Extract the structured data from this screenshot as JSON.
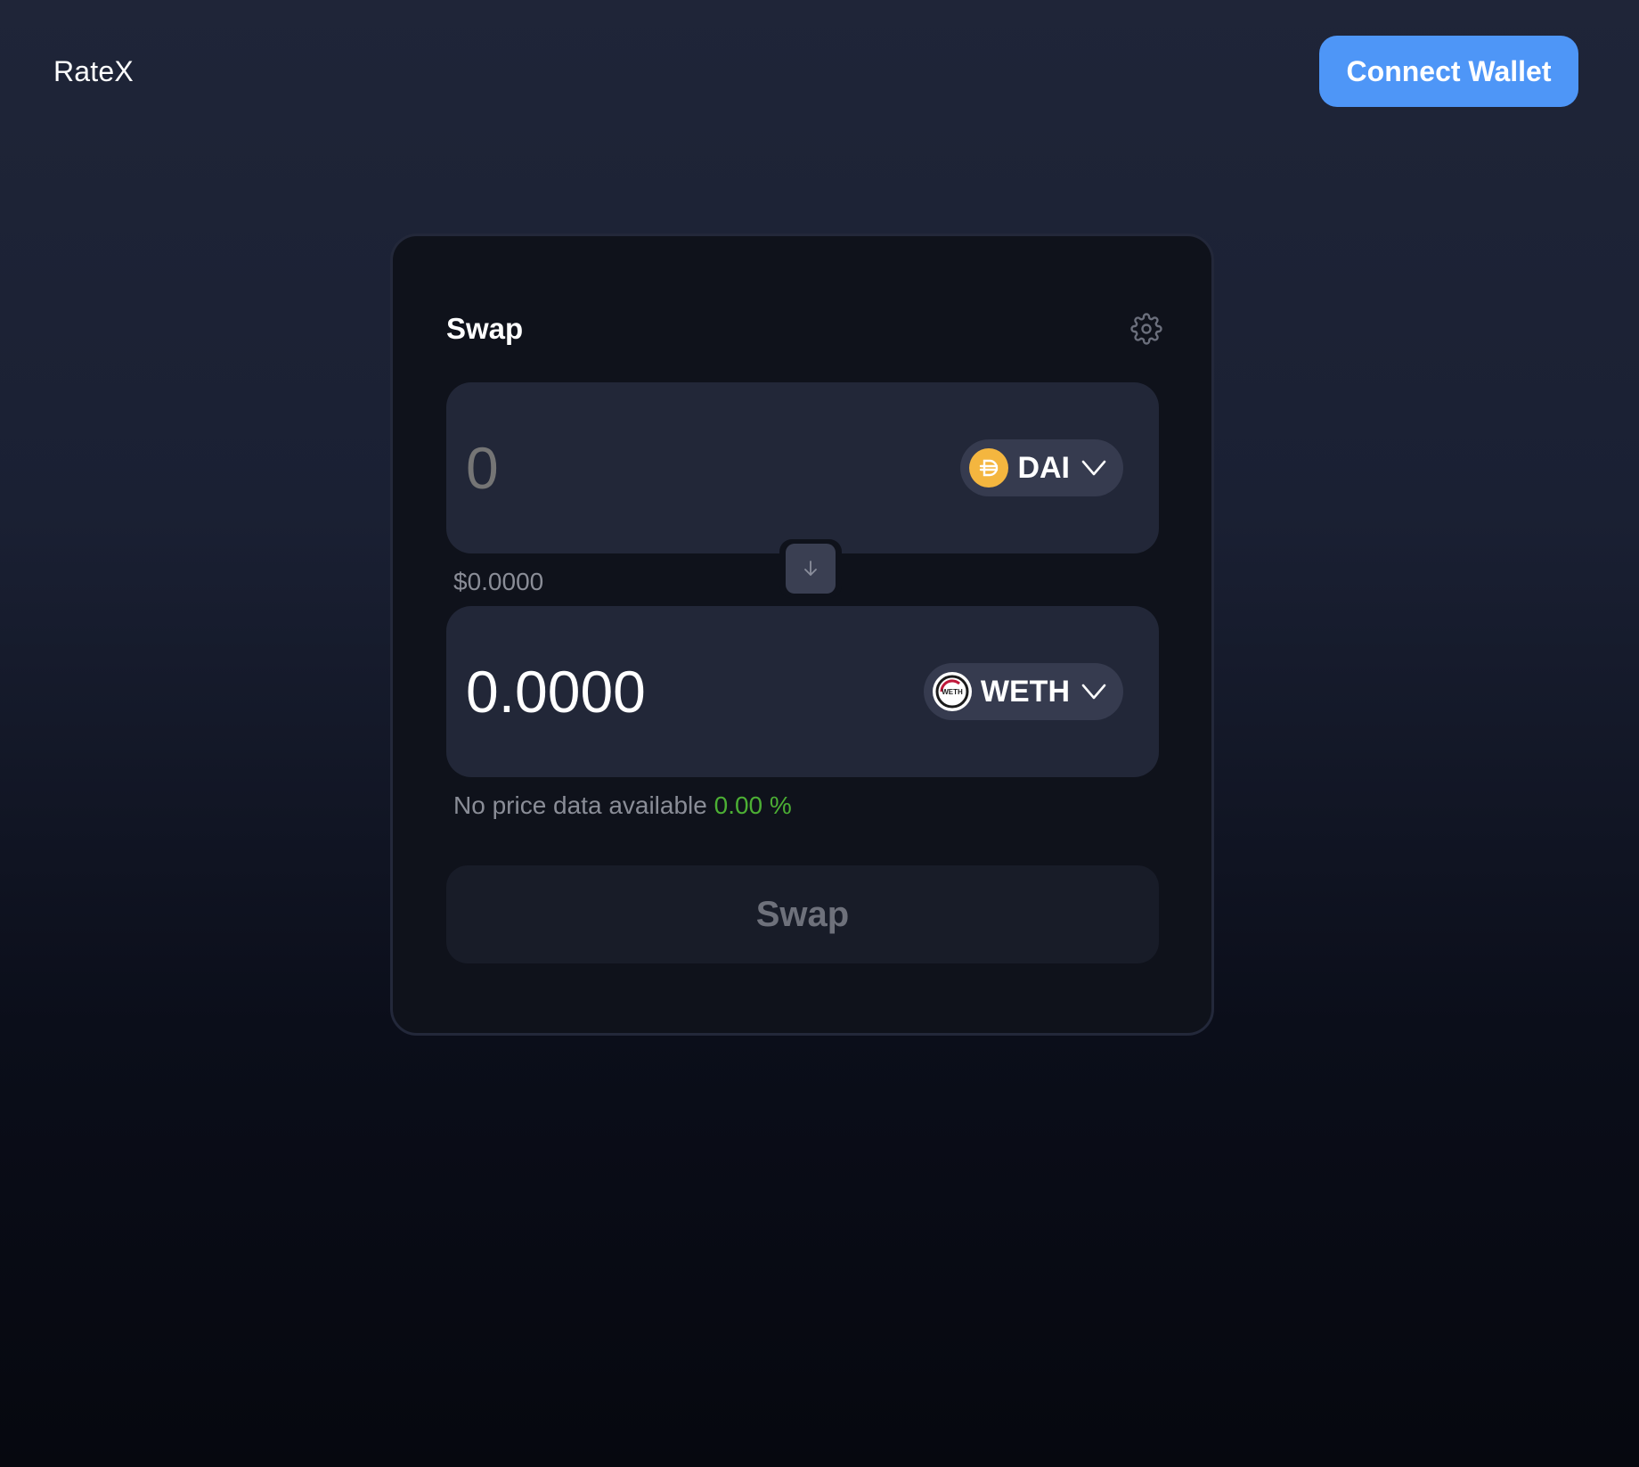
{
  "header": {
    "brand": "RateX",
    "connect_label": "Connect Wallet"
  },
  "swap_card": {
    "title": "Swap",
    "from": {
      "amount_placeholder": "0",
      "token_symbol": "DAI",
      "usd_value": "$0.0000"
    },
    "to": {
      "amount_value": "0.0000",
      "token_symbol": "WETH",
      "logo_text": "WETH"
    },
    "price_info": {
      "text": "No price data available",
      "percent": "0.00 %"
    },
    "swap_label": "Swap"
  },
  "colors": {
    "accent": "#4e96f7",
    "dai": "#f4b63f",
    "positive": "#4caf34"
  },
  "icons": [
    "gear-icon",
    "dai-logo-icon",
    "weth-logo-icon",
    "chevron-down-icon",
    "arrow-down-icon"
  ]
}
